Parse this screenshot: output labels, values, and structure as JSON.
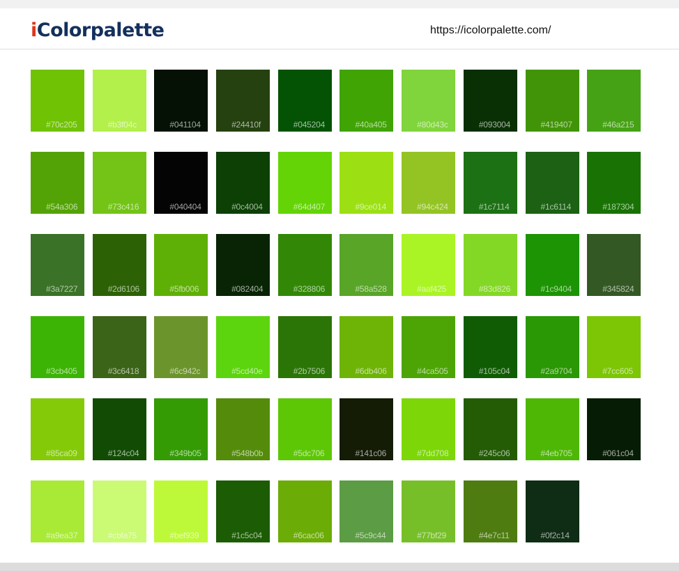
{
  "header": {
    "logo_i": "i",
    "logo_rest": "Colorpalette",
    "url": "https://icolorpalette.com/"
  },
  "swatches": [
    "#70c205",
    "#b3f04c",
    "#041104",
    "#24410f",
    "#045204",
    "#40a405",
    "#80d43c",
    "#093004",
    "#419407",
    "#46a215",
    "#54a306",
    "#73c416",
    "#040404",
    "#0c4004",
    "#64d407",
    "#9ce014",
    "#94c424",
    "#1c7114",
    "#1c6114",
    "#187304",
    "#3a7227",
    "#2d6106",
    "#5fb006",
    "#082404",
    "#328806",
    "#58a528",
    "#aaf425",
    "#83d826",
    "#1c9404",
    "#345824",
    "#3cb405",
    "#3c6418",
    "#6c942c",
    "#5cd40e",
    "#2b7506",
    "#6db406",
    "#4ca505",
    "#105c04",
    "#2a9704",
    "#7cc605",
    "#85ca09",
    "#124c04",
    "#349b05",
    "#548b0b",
    "#5dc706",
    "#141c06",
    "#7dd708",
    "#245c06",
    "#4eb705",
    "#061c04",
    "#a9ea37",
    "#cbfa75",
    "#bef939",
    "#1c5c04",
    "#6cac06",
    "#5c9c44",
    "#77bf29",
    "#4e7c11",
    "#0f2c14"
  ]
}
